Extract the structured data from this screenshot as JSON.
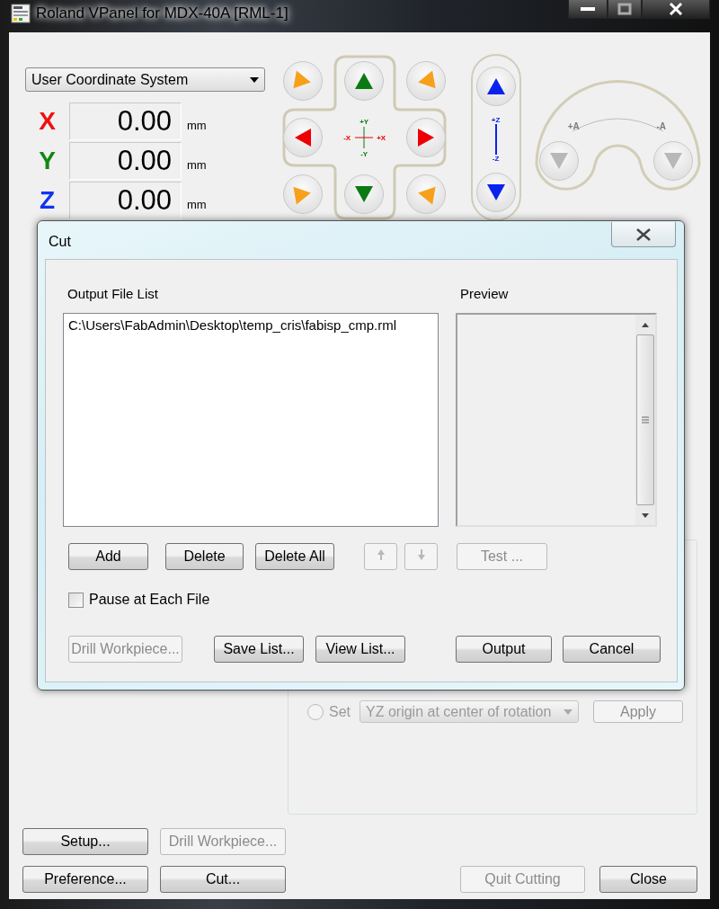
{
  "window": {
    "title": "Roland VPanel for MDX-40A [RML-1]"
  },
  "coordinate_system": {
    "value": "User Coordinate System"
  },
  "axes": [
    {
      "label": "X",
      "color": "#ee1111",
      "value": "0.00",
      "unit": "mm"
    },
    {
      "label": "Y",
      "color": "#118811",
      "value": "0.00",
      "unit": "mm"
    },
    {
      "label": "Z",
      "color": "#1133ee",
      "value": "0.00",
      "unit": "mm"
    }
  ],
  "xy_jog": {
    "plus_y": "+Y",
    "minus_y": "-Y",
    "minus_x": "-X",
    "plus_x": "+X"
  },
  "z_jog": {
    "plus": "+Z",
    "minus": "-Z"
  },
  "a_jog": {
    "plus": "+A",
    "minus": "-A",
    "disabled": true
  },
  "origin_panel": {
    "set_label": "Set",
    "set_selected": false,
    "origin_option": "YZ origin at center of rotation",
    "apply": "Apply"
  },
  "main_buttons": [
    {
      "label": "Setup...",
      "disabled": false
    },
    {
      "label": "Drill Workpiece...",
      "disabled": true
    },
    {
      "label": "Preference...",
      "disabled": false
    },
    {
      "label": "Cut...",
      "disabled": false
    },
    {
      "label": "Quit Cutting",
      "disabled": true
    },
    {
      "label": "Close",
      "disabled": false
    }
  ],
  "dialog": {
    "title": "Cut",
    "output_file_list_label": "Output File List",
    "files": [
      "C:\\Users\\FabAdmin\\Desktop\\temp_cris\\fabisp_cmp.rml"
    ],
    "preview_label": "Preview",
    "list_buttons": [
      {
        "label": "Add",
        "disabled": false
      },
      {
        "label": "Delete",
        "disabled": false
      },
      {
        "label": "Delete All",
        "disabled": false
      }
    ],
    "move_up_disabled": true,
    "move_down_disabled": true,
    "test": {
      "label": "Test ...",
      "disabled": true
    },
    "pause_at_each_file": {
      "label": "Pause at Each File",
      "checked": false
    },
    "bottom_buttons": [
      {
        "label": "Drill Workpiece...",
        "disabled": true
      },
      {
        "label": "Save List...",
        "disabled": false
      },
      {
        "label": "View List...",
        "disabled": false
      },
      {
        "label": "Output",
        "disabled": false
      },
      {
        "label": "Cancel",
        "disabled": false
      }
    ]
  }
}
